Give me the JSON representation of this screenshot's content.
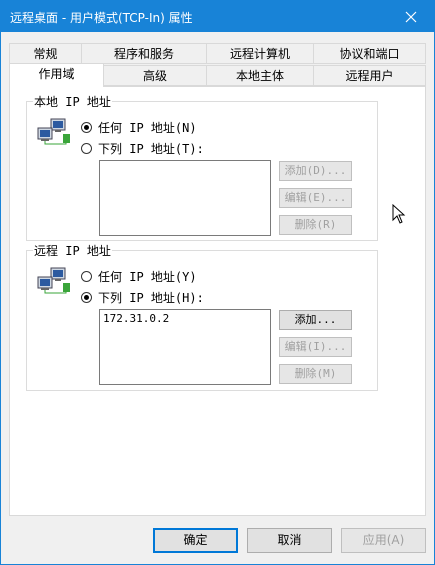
{
  "window": {
    "title": "远程桌面 - 用户模式(TCP-In) 属性",
    "close_icon": "close-icon",
    "accent_color": "#1883d7"
  },
  "tabs": {
    "row1": [
      {
        "label": "常规"
      },
      {
        "label": "程序和服务"
      },
      {
        "label": "远程计算机"
      },
      {
        "label": "协议和端口"
      }
    ],
    "row2": [
      {
        "label": "作用域",
        "selected": true
      },
      {
        "label": "高级"
      },
      {
        "label": "本地主体"
      },
      {
        "label": "远程用户"
      }
    ]
  },
  "local_ip": {
    "group_label": "本地 IP 地址",
    "icon": "network-computers-icon",
    "option_any": "任何 IP 地址(N)",
    "option_list": "下列 IP 地址(T):",
    "selected": "any",
    "addresses": [],
    "add_label": "添加(D)...",
    "edit_label": "编辑(E)...",
    "remove_label": "删除(R)"
  },
  "remote_ip": {
    "group_label": "远程 IP 地址",
    "icon": "network-computers-icon",
    "option_any": "任何 IP 地址(Y)",
    "option_list": "下列 IP 地址(H):",
    "selected": "list",
    "addresses": [
      "172.31.0.2"
    ],
    "add_label": "添加...",
    "edit_label": "编辑(I)...",
    "remove_label": "删除(M)"
  },
  "footer": {
    "ok_label": "确定",
    "cancel_label": "取消",
    "apply_label": "应用(A)"
  }
}
